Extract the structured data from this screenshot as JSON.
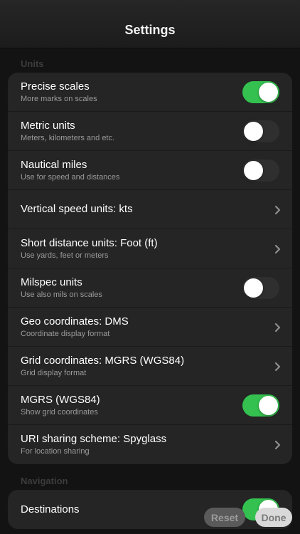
{
  "header": {
    "title": "Settings"
  },
  "sections": {
    "units": "Units",
    "navigation": "Navigation"
  },
  "units_rows": [
    {
      "label": "Precise scales",
      "sub": "More marks on scales",
      "control": "toggle",
      "on": true
    },
    {
      "label": "Metric units",
      "sub": "Meters, kilometers and etc.",
      "control": "toggle",
      "on": false
    },
    {
      "label": "Nautical miles",
      "sub": "Use for speed and distances",
      "control": "toggle",
      "on": false
    },
    {
      "label": "Vertical speed units: kts",
      "sub": "",
      "control": "chevron"
    },
    {
      "label": "Short distance units: Foot (ft)",
      "sub": "Use yards, feet or meters",
      "control": "chevron"
    },
    {
      "label": "Milspec units",
      "sub": "Use also mils on scales",
      "control": "toggle",
      "on": false
    },
    {
      "label": "Geo coordinates: DMS",
      "sub": "Coordinate display format",
      "control": "chevron"
    },
    {
      "label": "Grid coordinates: MGRS (WGS84)",
      "sub": "Grid display format",
      "control": "chevron"
    },
    {
      "label": "MGRS (WGS84)",
      "sub": "Show grid coordinates",
      "control": "toggle",
      "on": true
    },
    {
      "label": "URI sharing scheme: Spyglass",
      "sub": "For location sharing",
      "control": "chevron"
    }
  ],
  "navigation_rows": [
    {
      "label": "Destinations",
      "sub": "",
      "control": "toggle",
      "on": true
    }
  ],
  "buttons": {
    "reset": "Reset",
    "done": "Done"
  },
  "colors": {
    "toggle_on": "#34c14f",
    "toggle_off": "#2f2f2f",
    "background": "#131313",
    "group": "#252525"
  }
}
